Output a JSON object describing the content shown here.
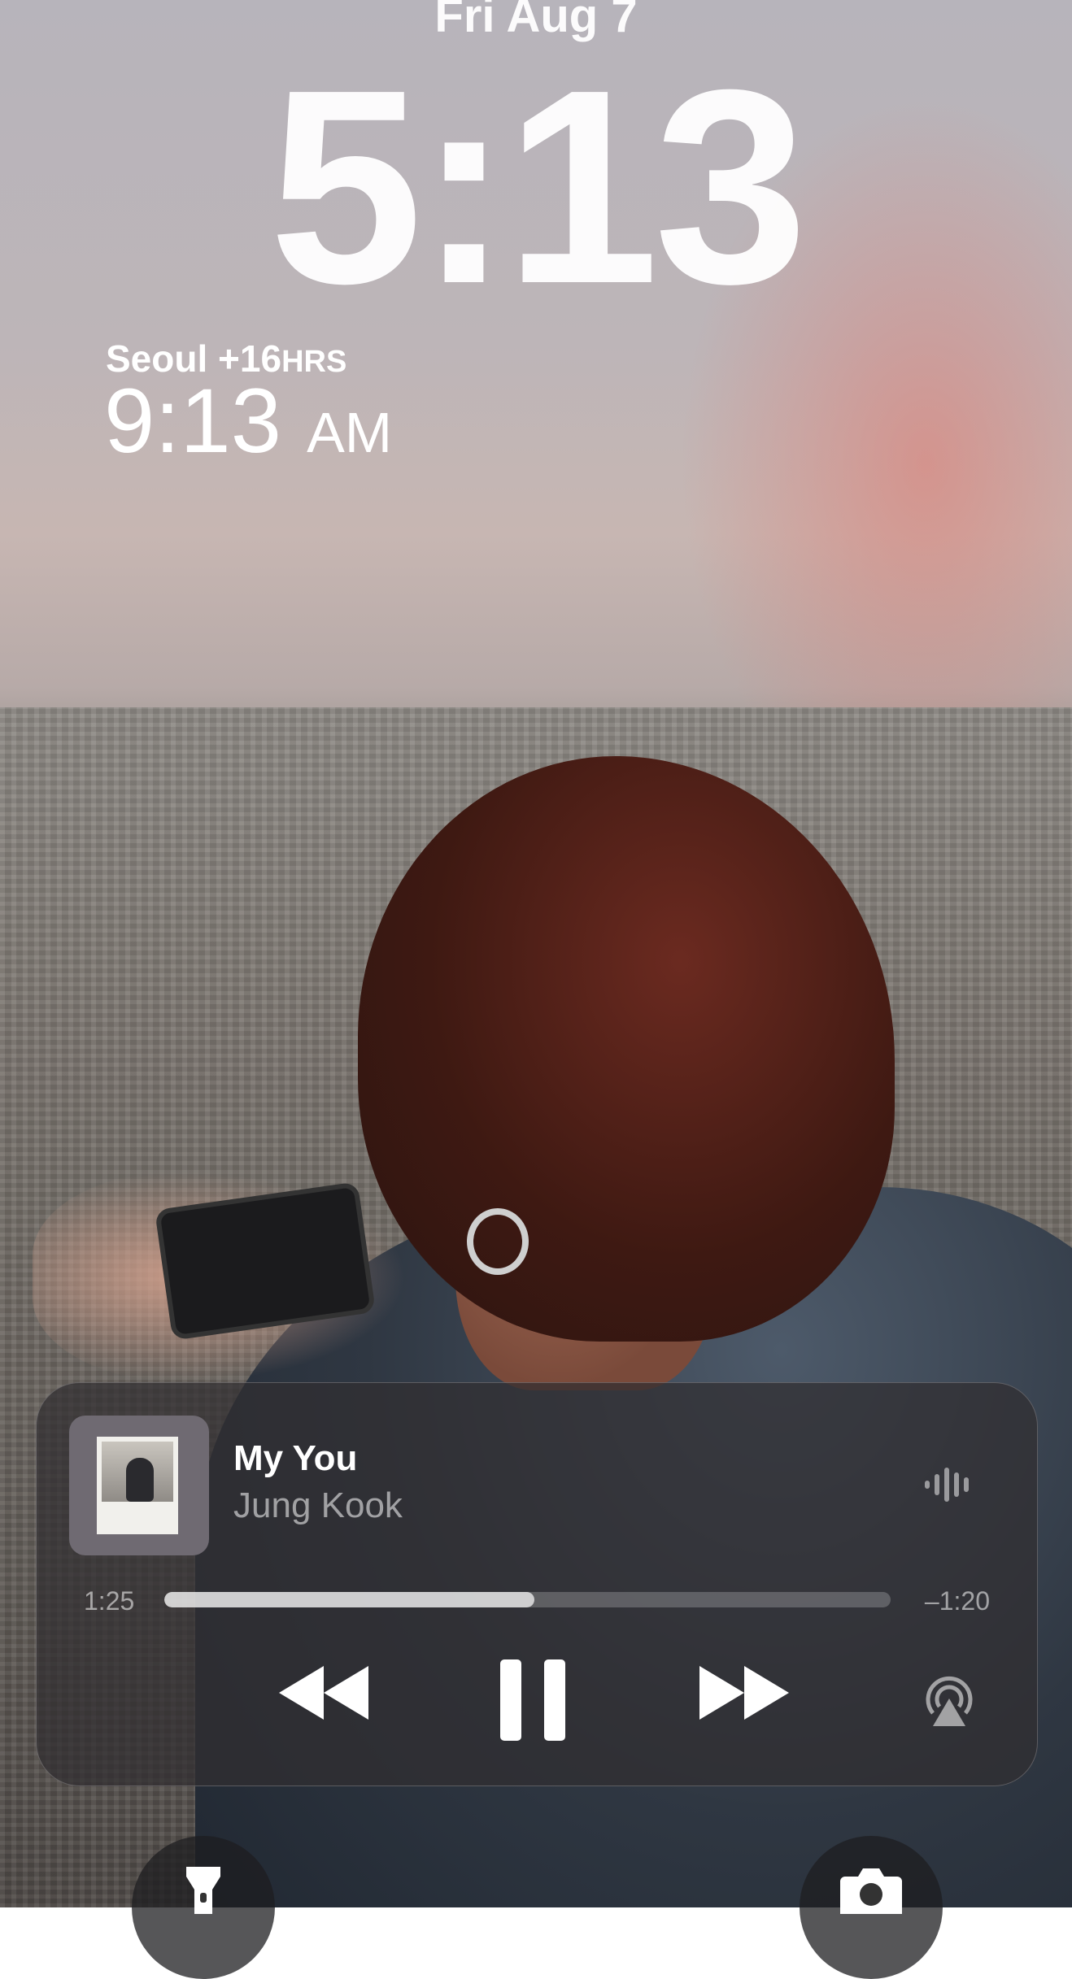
{
  "lockscreen": {
    "date": "Fri Aug 7",
    "time": "5:13"
  },
  "world_clock": {
    "city": "Seoul",
    "offset": "+16",
    "offset_unit": "HRS",
    "time": "9:13",
    "ampm": "AM"
  },
  "now_playing": {
    "title": "My You",
    "artist": "Jung Kook",
    "elapsed": "1:25",
    "remaining": "–1:20",
    "progress_fraction": 0.51,
    "icons": {
      "waveform": "waveform-icon",
      "rewind": "rewind-icon",
      "pause": "pause-icon",
      "forward": "fast-forward-icon",
      "airplay": "airplay-icon"
    }
  },
  "quick_actions": {
    "left": "flashlight-icon",
    "right": "camera-icon"
  }
}
